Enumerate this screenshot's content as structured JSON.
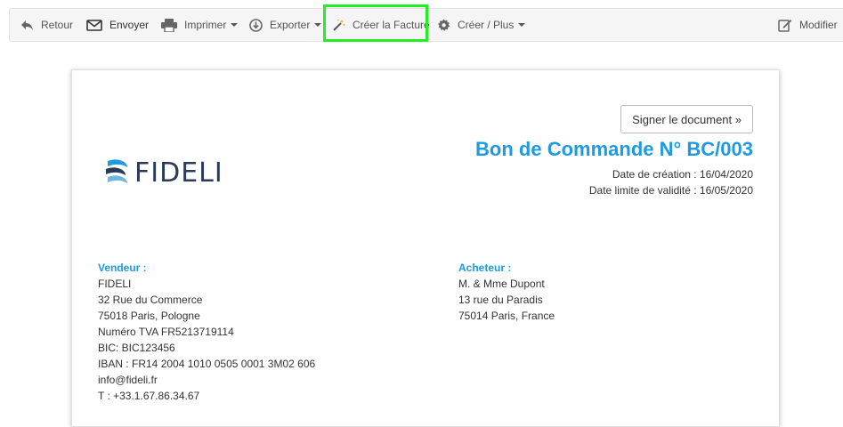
{
  "toolbar": {
    "back": "Retour",
    "send": "Envoyer",
    "print": "Imprimer",
    "export": "Exporter",
    "create_invoice": "Créer la Facture",
    "create_more": "Créer / Plus",
    "edit": "Modifier"
  },
  "document": {
    "sign_button": "Signer le document »",
    "title": "Bon de Commande N° BC/003",
    "created": "Date de création : 16/04/2020",
    "valid_until": "Date limite de validité : 16/05/2020",
    "logo_text": "FIDELI"
  },
  "seller": {
    "title": "Vendeur :",
    "lines": [
      "FIDELI",
      "32 Rue du Commerce",
      "75018 Paris, Pologne",
      "Numéro TVA FR5213719114",
      "BIC: BIC123456",
      "IBAN : FR14 2004 1010 0505 0001 3M02 606",
      "info@fideli.fr",
      "T : +33.1.67.86.34.67"
    ]
  },
  "buyer": {
    "title": "Acheteur :",
    "lines": [
      "M. & Mme Dupont",
      "13 rue du Paradis",
      "75014 Paris, France"
    ]
  },
  "colors": {
    "accent": "#1e9be0",
    "highlight": "#22ee22",
    "logo": "#2c3a5a"
  }
}
